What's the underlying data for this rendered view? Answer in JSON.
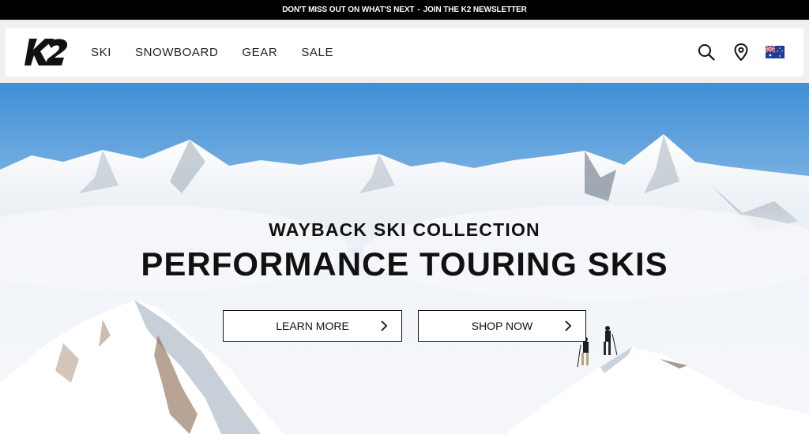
{
  "announcement": {
    "lead": "DON'T MISS OUT ON WHAT'S NEXT",
    "separator": "-",
    "cta": "JOIN THE K2 NEWSLETTER"
  },
  "header": {
    "logo_text": "K2",
    "nav": [
      {
        "label": "SKI"
      },
      {
        "label": "SNOWBOARD"
      },
      {
        "label": "GEAR"
      },
      {
        "label": "SALE"
      }
    ],
    "icons": [
      "search-icon",
      "location-pin-icon",
      "australia-flag-icon"
    ]
  },
  "hero": {
    "subtitle": "WAYBACK SKI COLLECTION",
    "title": "PERFORMANCE TOURING SKIS",
    "buttons": [
      {
        "label": "LEARN MORE"
      },
      {
        "label": "SHOP NOW"
      }
    ]
  },
  "colors": {
    "announcement_bg": "#000000",
    "sky_top": "#3f8ed6",
    "text": "#111111"
  }
}
